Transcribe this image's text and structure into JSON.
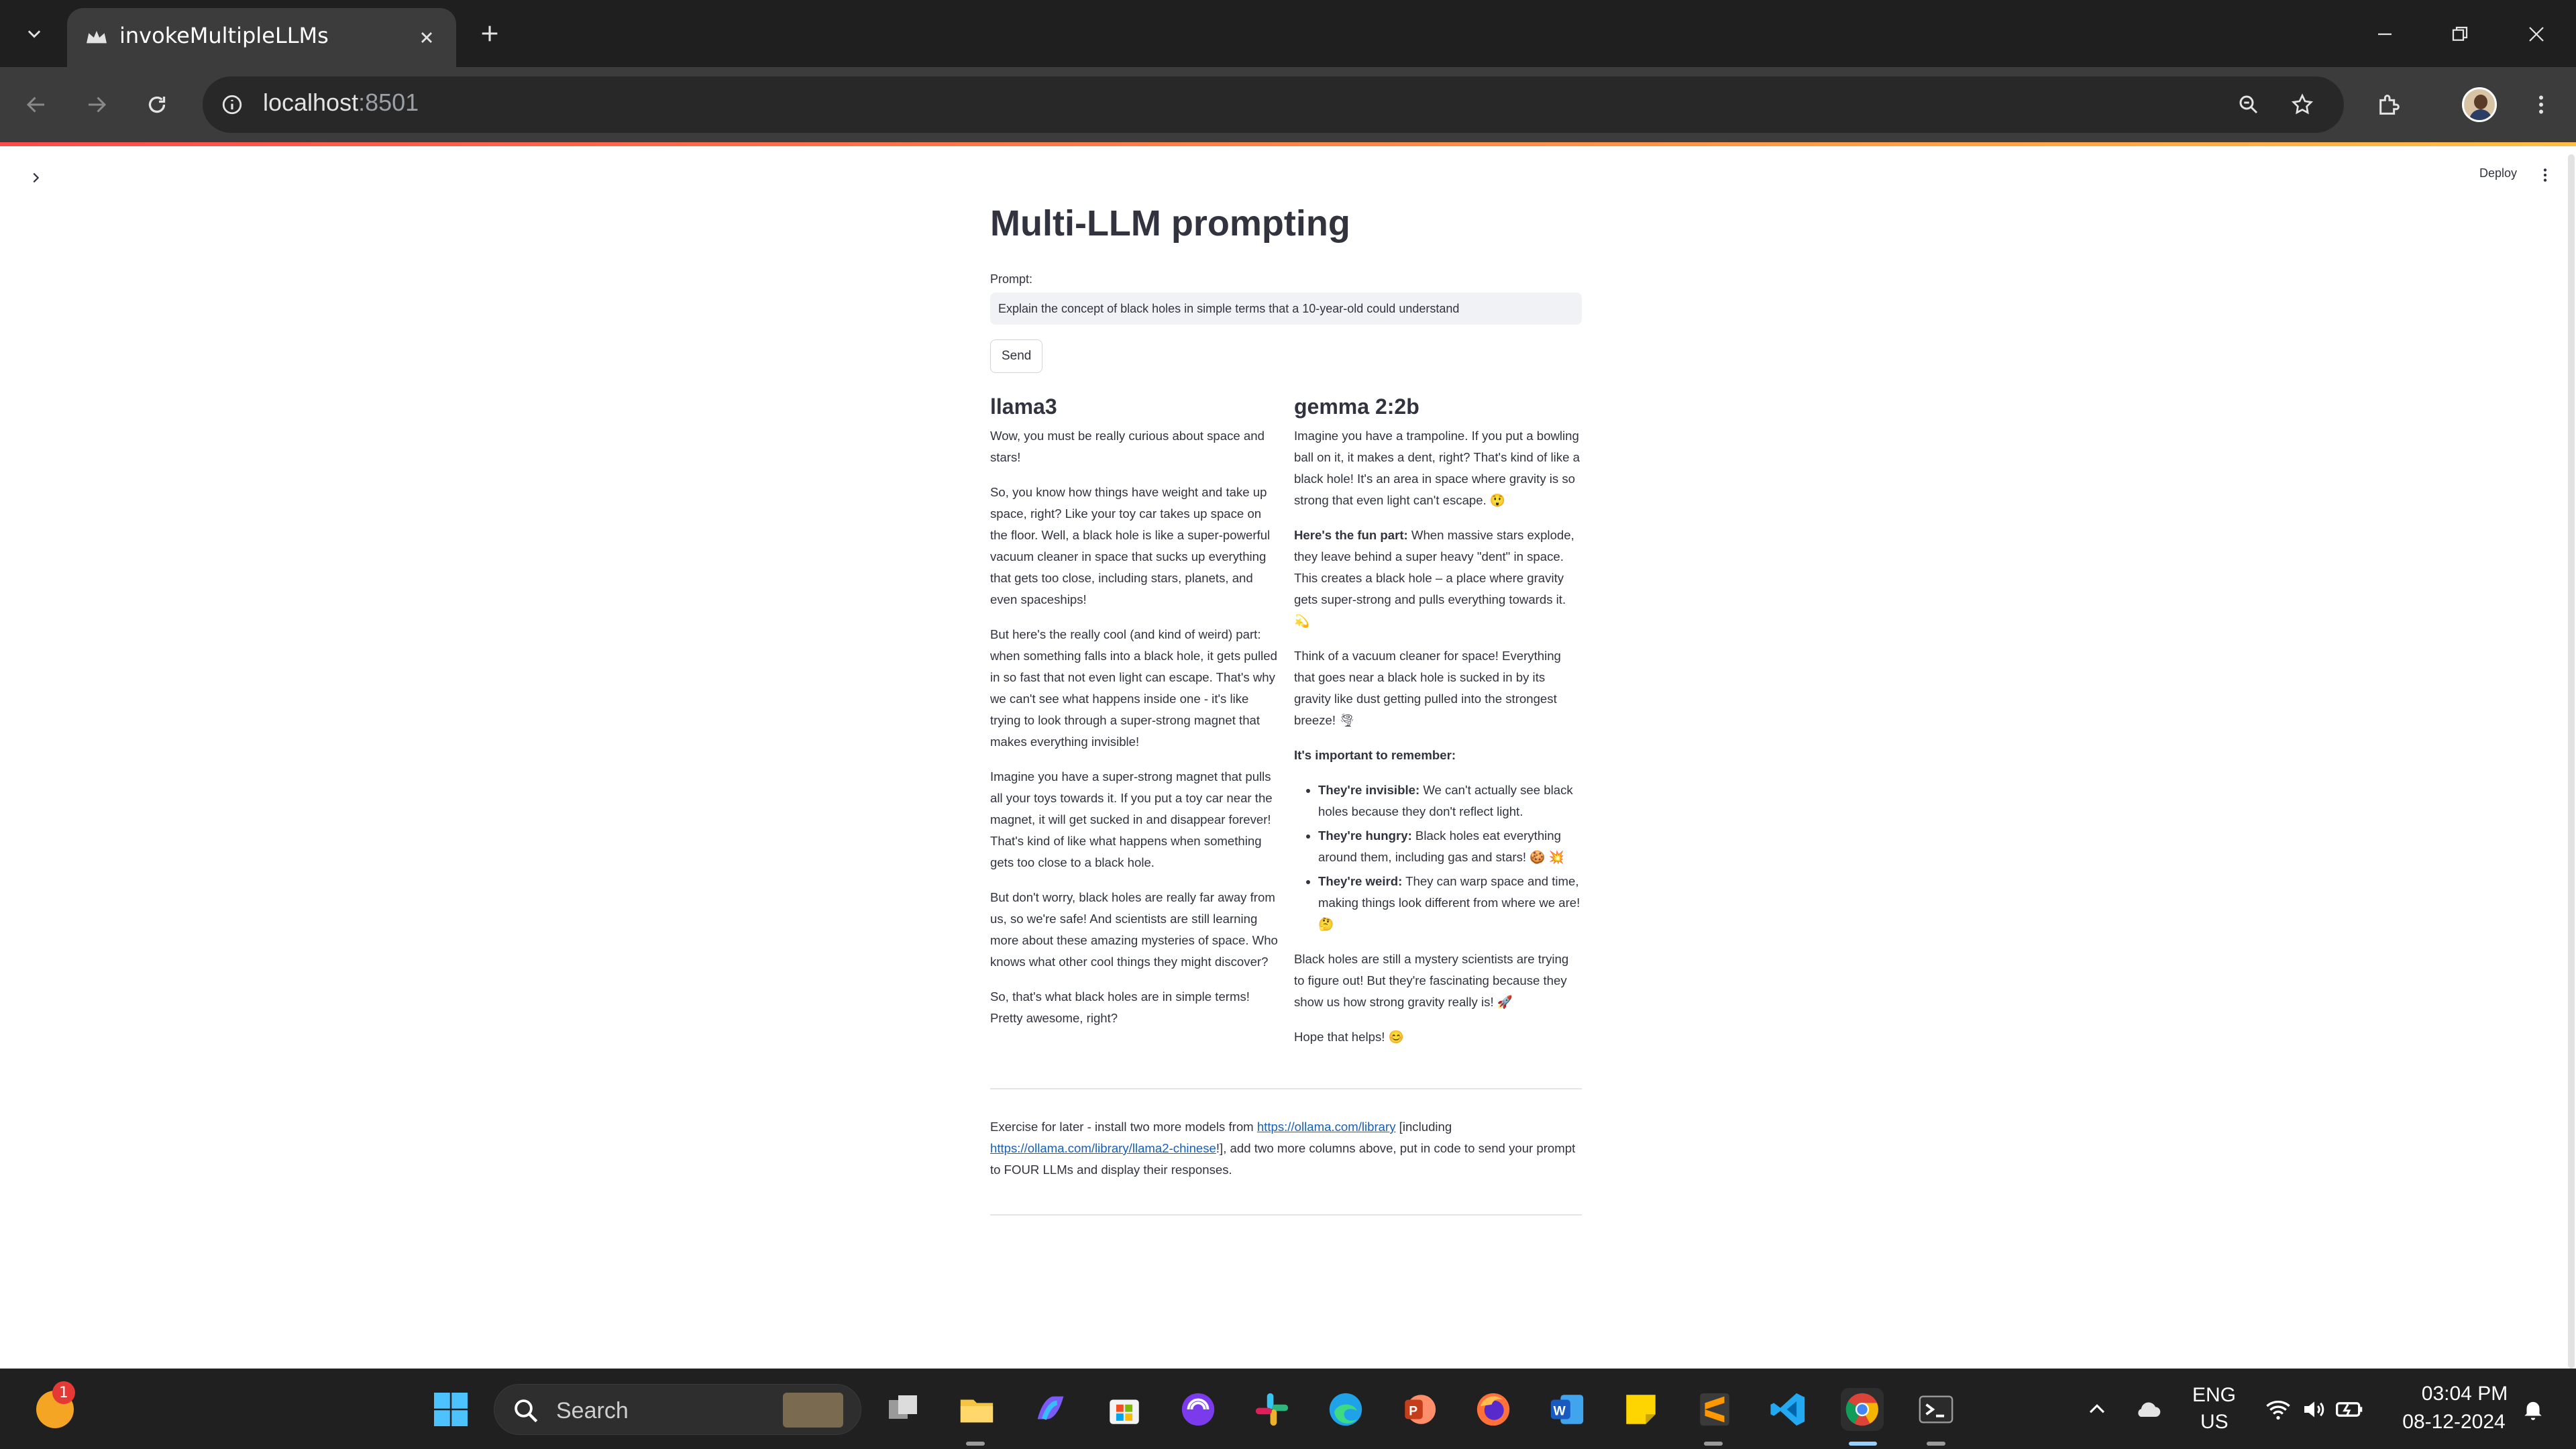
{
  "browser": {
    "tab_title": "invokeMultipleLLMs",
    "url_host": "localhost",
    "url_port": ":8501",
    "accent_gradient": [
      "#ff4b4b",
      "#ffbd45"
    ]
  },
  "app": {
    "deploy_label": "Deploy",
    "title": "Multi-LLM prompting",
    "prompt_label": "Prompt:",
    "prompt_value": "Explain the concept of black holes in simple terms that a 10-year-old could understand",
    "send_label": "Send",
    "columns": [
      {
        "header": "llama3",
        "paragraphs": [
          "Wow, you must be really curious about space and stars!",
          "So, you know how things have weight and take up space, right? Like your toy car takes up space on the floor. Well, a black hole is like a super-powerful vacuum cleaner in space that sucks up everything that gets too close, including stars, planets, and even spaceships!",
          "But here's the really cool (and kind of weird) part: when something falls into a black hole, it gets pulled in so fast that not even light can escape. That's why we can't see what happens inside one - it's like trying to look through a super-strong magnet that makes everything invisible!",
          "Imagine you have a super-strong magnet that pulls all your toys towards it. If you put a toy car near the magnet, it will get sucked in and disappear forever! That's kind of like what happens when something gets too close to a black hole.",
          "But don't worry, black holes are really far away from us, so we're safe! And scientists are still learning more about these amazing mysteries of space. Who knows what other cool things they might discover?",
          "So, that's what black holes are in simple terms! Pretty awesome, right?"
        ]
      },
      {
        "header": "gemma 2:2b",
        "p1": "Imagine you have a trampoline. If you put a bowling ball on it, it makes a dent, right? That's kind of like a black hole! It's an area in space where gravity is so strong that even light can't escape. 😲",
        "p2_bold": "Here's the fun part:",
        "p2_rest": " When massive stars explode, they leave behind a super heavy \"dent\" in space. This creates a black hole – a place where gravity gets super-strong and pulls everything towards it. 💫",
        "p3": "Think of a vacuum cleaner for space! Everything that goes near a black hole is sucked in by its gravity like dust getting pulled into the strongest breeze! 🌪",
        "p4_bold": "It's important to remember:",
        "bullets": [
          {
            "bold": "They're invisible:",
            "text": " We can't actually see black holes because they don't reflect light."
          },
          {
            "bold": "They're hungry:",
            "text": " Black holes eat everything around them, including gas and stars! 🍪 💥"
          },
          {
            "bold": "They're weird:",
            "text": " They can warp space and time, making things look different from where we are! 🤔"
          }
        ],
        "p5": "Black holes are still a mystery scientists are trying to figure out! But they're fascinating because they show us how strong gravity really is! 🚀",
        "p6": "Hope that helps! 😊"
      }
    ],
    "exercise": {
      "t1": "Exercise for later - install two more models from ",
      "link1": "https://ollama.com/library",
      "t2": " [including ",
      "link2": "https://ollama.com/library/llama2-chinese",
      "t3": "!], add two more columns above, put in code to send your prompt to FOUR LLMs and display their responses."
    }
  },
  "taskbar": {
    "weather_badge": "1",
    "search_placeholder": "Search",
    "language": "ENG",
    "region": "US",
    "time": "03:04 PM",
    "date": "08-12-2024"
  }
}
